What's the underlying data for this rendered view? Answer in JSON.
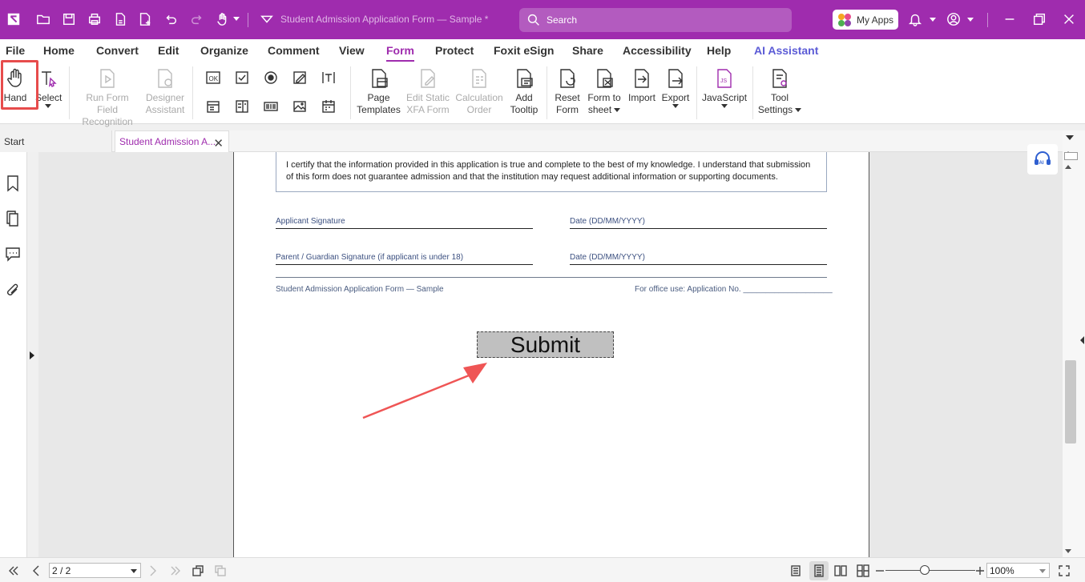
{
  "titlebar": {
    "doc_title": "Student Admission Application Form — Sample *",
    "search_placeholder": "Search",
    "myapps_label": "My Apps",
    "accent_color": "#9f2cae"
  },
  "menu": {
    "items": [
      "File",
      "Home",
      "Convert",
      "Edit",
      "Organize",
      "Comment",
      "View",
      "Form",
      "Protect",
      "Foxit eSign",
      "Share",
      "Accessibility",
      "Help",
      "AI Assistant"
    ],
    "active": "Form"
  },
  "ribbon": {
    "hand": "Hand",
    "select": "Select",
    "run_form_1": "Run Form Field",
    "run_form_2": "Recognition",
    "designer_1": "Designer",
    "designer_2": "Assistant",
    "page_templates_1": "Page",
    "page_templates_2": "Templates",
    "edit_static_1": "Edit Static",
    "edit_static_2": "XFA Form",
    "calc_order_1": "Calculation",
    "calc_order_2": "Order",
    "add_tooltip_1": "Add",
    "add_tooltip_2": "Tooltip",
    "reset_form_1": "Reset",
    "reset_form_2": "Form",
    "form_to_sheet_1": "Form to",
    "form_to_sheet_2": "sheet",
    "import": "Import",
    "export": "Export",
    "javascript": "JavaScript",
    "tool_settings_1": "Tool",
    "tool_settings_2": "Settings",
    "button_field_icon_text": "OK"
  },
  "tabs": {
    "start": "Start",
    "doc": "Student Admission A..."
  },
  "page": {
    "certification": "I certify that the information provided in this application is true and complete to the best of my knowledge. I understand that submission of this form does not guarantee admission and that the institution may request additional information or supporting documents.",
    "applicant_signature": "Applicant Signature",
    "date1": "Date (DD/MM/YYYY)",
    "parent_signature": "Parent / Guardian Signature (if applicant is under 18)",
    "date2": "Date (DD/MM/YYYY)",
    "footer_left": "Student Admission Application Form — Sample",
    "footer_right": "For office use: Application No. ____________________",
    "submit_label": "Submit"
  },
  "statusbar": {
    "page_value": "2 / 2",
    "zoom_value": "100%",
    "zoom_level": 0.44
  }
}
